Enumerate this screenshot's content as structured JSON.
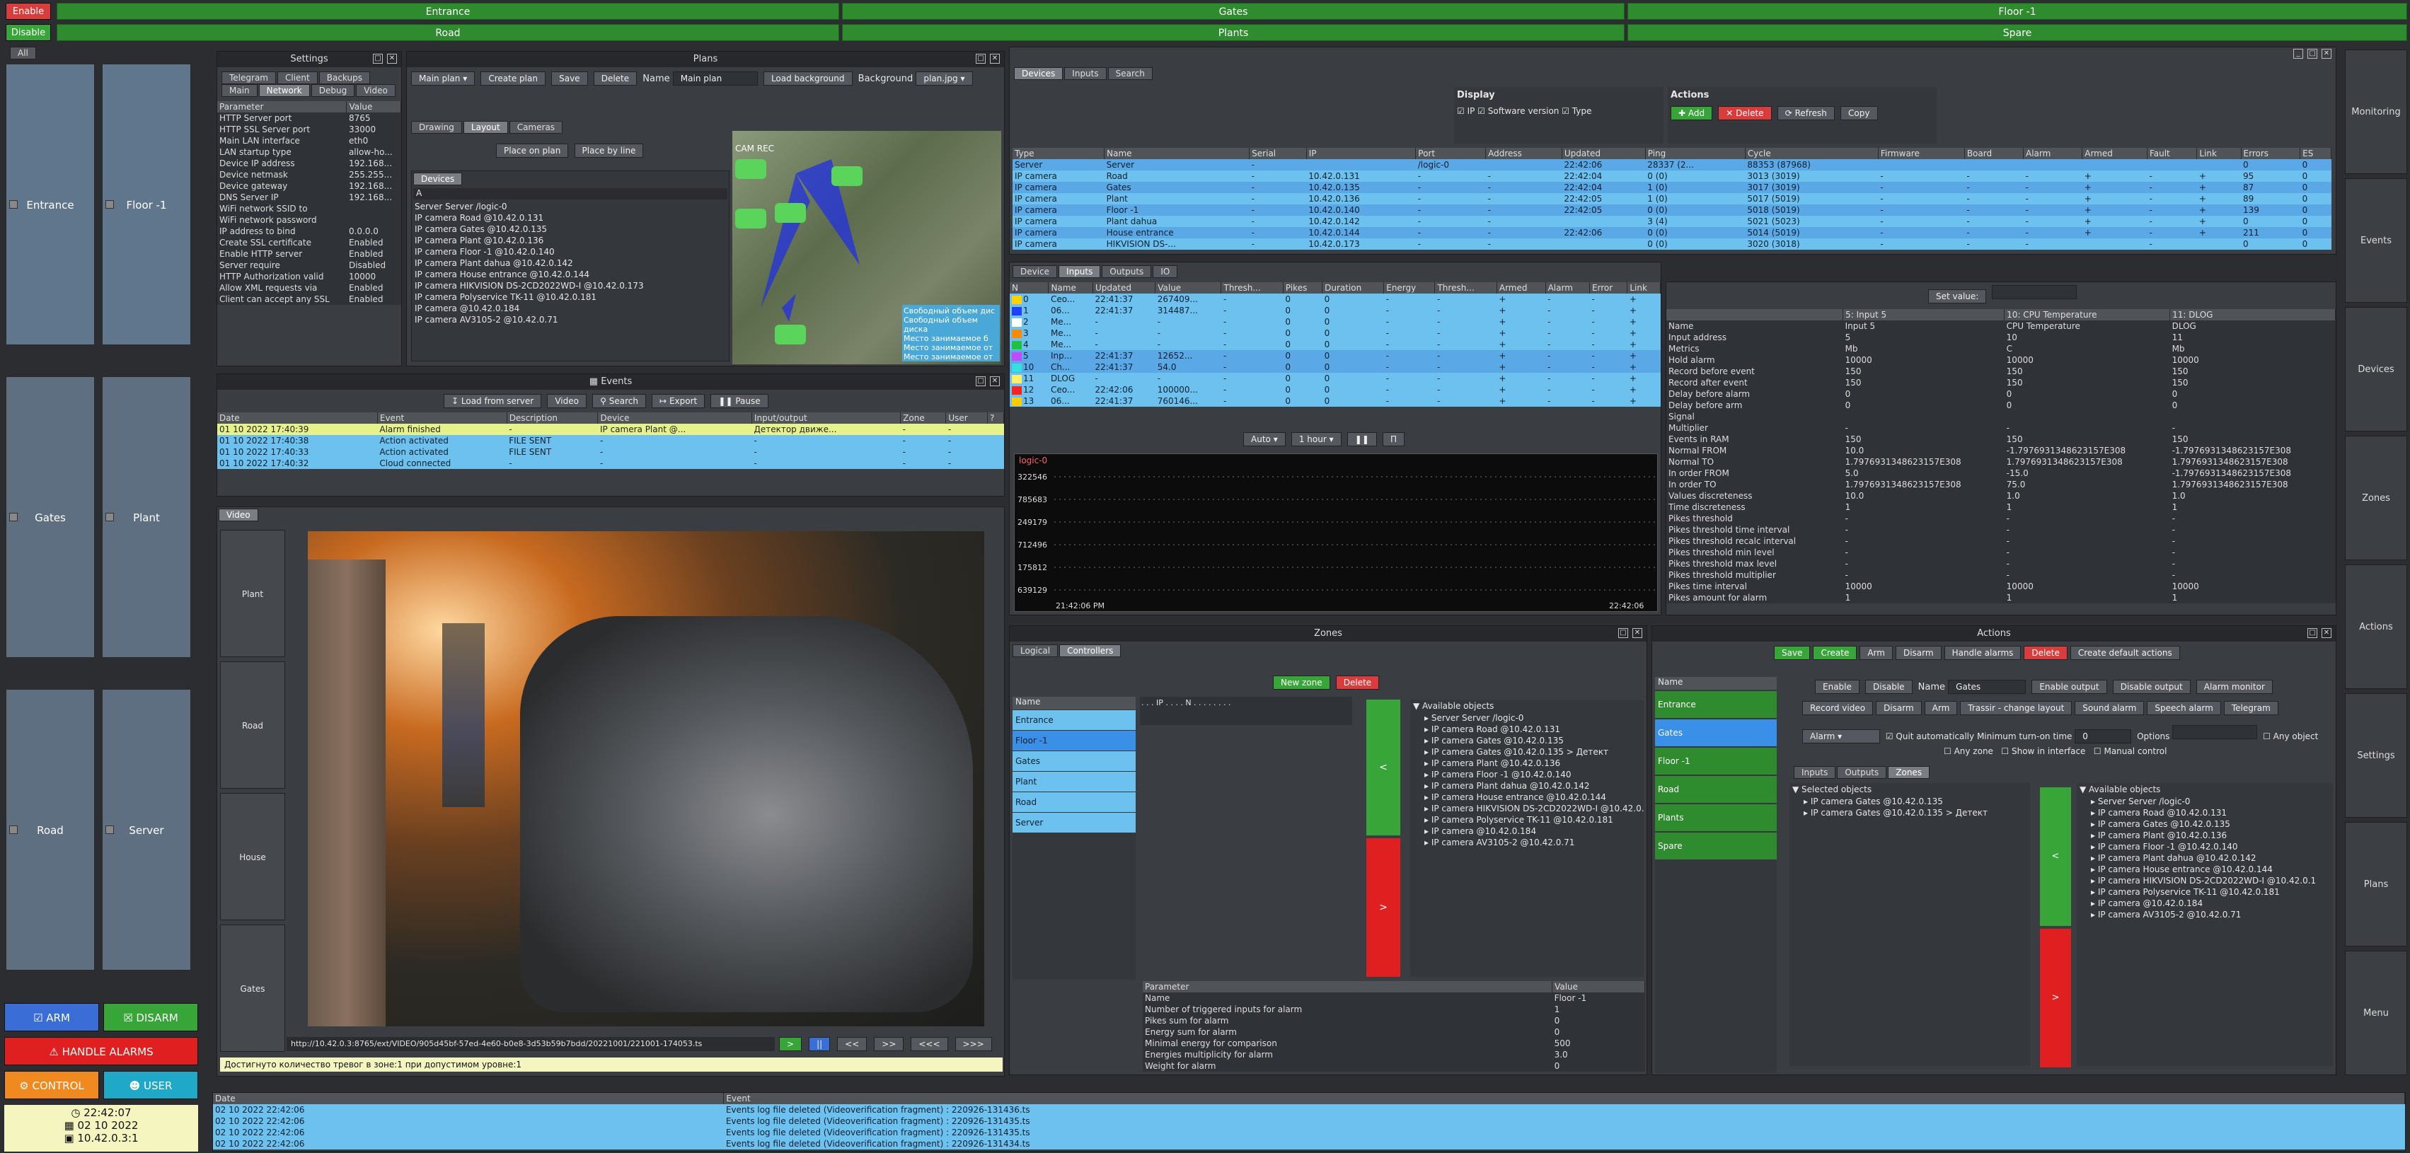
{
  "header": {
    "enable": "Enable",
    "disable": "Disable",
    "top_bars": [
      "Entrance",
      "Gates",
      "Floor -1"
    ],
    "bottom_bars": [
      "Road",
      "Plants",
      "Spare"
    ]
  },
  "sidebar": {
    "all_tab": "All",
    "zones": [
      "Entrance",
      "Floor -1",
      "Gates",
      "Plant",
      "Road",
      "Server"
    ],
    "arm": "ARM",
    "disarm": "DISARM",
    "handle_alarms": "HANDLE ALARMS",
    "control": "CONTROL",
    "user": "USER",
    "time": "22:42:07",
    "date": "02 10 2022",
    "ip": "10.42.0.3:1"
  },
  "settings": {
    "title": "Settings",
    "tabs1": [
      "Telegram",
      "Client",
      "Backups"
    ],
    "tabs2": [
      "Main",
      "Network",
      "Debug",
      "Video"
    ],
    "headers": [
      "Parameter",
      "Value"
    ],
    "rows": [
      [
        "HTTP Server port",
        "8765"
      ],
      [
        "HTTP SSL Server port",
        "33000"
      ],
      [
        "Main LAN interface",
        "eth0"
      ],
      [
        "LAN startup type",
        "allow-ho..."
      ],
      [
        "Device IP address",
        "192.168..."
      ],
      [
        "Device netmask",
        "255.255..."
      ],
      [
        "Device gateway",
        "192.168..."
      ],
      [
        "DNS Server IP",
        "192.168..."
      ],
      [
        "WiFi network SSID to",
        ""
      ],
      [
        "WiFi network password",
        ""
      ],
      [
        "IP address to bind",
        "0.0.0.0"
      ],
      [
        "Create SSL certificate",
        "Enabled"
      ],
      [
        "Enable HTTP server",
        "Enabled"
      ],
      [
        "Server require",
        "Disabled"
      ],
      [
        "HTTP Authorization valid",
        "10000"
      ],
      [
        "Allow XML requests via",
        "Enabled"
      ],
      [
        "Client can accept any SSL",
        "Enabled"
      ]
    ]
  },
  "plans": {
    "title": "Plans",
    "plan_select": "Main plan",
    "create": "Create plan",
    "save": "Save",
    "delete": "Delete",
    "name_label": "Name",
    "name_value": "Main plan",
    "load_bg": "Load background",
    "bg_label": "Background",
    "bg_value": "plan.jpg",
    "tabs": [
      "Drawing",
      "Layout",
      "Cameras"
    ],
    "place_on": "Place on plan",
    "place_line": "Place by line",
    "devices_tab": "Devices",
    "filter": "A",
    "devices": [
      "Server Server /logic-0",
      "IP camera Road @10.42.0.131",
      "IP camera Gates @10.42.0.135",
      "IP camera Plant @10.42.0.136",
      "IP camera Floor -1 @10.42.0.140",
      "IP camera Plant dahua @10.42.0.142",
      "IP camera House entrance @10.42.0.144",
      "IP camera HIKVISION DS-2CD2022WD-I @10.42.0.173",
      "IP camera Polyservice TK-11 @10.42.0.181",
      "IP camera @10.42.0.184",
      "IP camera AV3105-2 @10.42.0.71"
    ],
    "map_label": "CAM REC",
    "map_legend": [
      "Свободный объем дис",
      "Свободный объем диска",
      "Место занимаемое б",
      "Место занимаемое от",
      "Место занимаемое от"
    ]
  },
  "events": {
    "title": "Events",
    "load": "Load from server",
    "video": "Video",
    "search": "Search",
    "export": "Export",
    "pause": "Pause",
    "headers": [
      "Date",
      "Event",
      "Description",
      "Device",
      "Input/output",
      "Zone",
      "User",
      "?"
    ],
    "rows": [
      [
        "01 10 2022 17:40:39",
        "Alarm finished",
        "-",
        "IP camera Plant @...",
        "Детектор движе...",
        "-",
        "-",
        ""
      ],
      [
        "01 10 2022 17:40:38",
        "Action activated",
        "FILE SENT",
        "-",
        "-",
        "-",
        "-",
        ""
      ],
      [
        "01 10 2022 17:40:33",
        "Action activated",
        "FILE SENT",
        "-",
        "-",
        "-",
        "-",
        ""
      ],
      [
        "01 10 2022 17:40:32",
        "Cloud connected",
        "-",
        "-",
        "-",
        "-",
        "-",
        ""
      ]
    ]
  },
  "video": {
    "tab": "Video",
    "cams": [
      "Plant",
      "Road",
      "House entrance",
      "Gates"
    ],
    "url": "http://10.42.0.3:8765/ext/VIDEO/905d45bf-57ed-4e60-b0e8-3d53b59b7bdd/20221001/221001-174053.ts",
    "controls": [
      ">",
      "||",
      "<<",
      ">>",
      "<<<",
      ">>>"
    ],
    "status": "Достигнуто количество тревог в зоне:1 при допустимом уровне:1"
  },
  "devices_panel": {
    "tabs": [
      "Devices",
      "Inputs",
      "Search"
    ],
    "display_title": "Display",
    "display_opts": [
      "IP",
      "Software version",
      "Type"
    ],
    "actions_title": "Actions",
    "add": "Add",
    "delete": "Delete",
    "refresh": "Refresh",
    "copy": "Copy",
    "headers": [
      "Type",
      "Name",
      "Serial",
      "IP",
      "Port",
      "Address",
      "Updated",
      "Ping",
      "Cycle",
      "Firmware",
      "Board",
      "Alarm",
      "Armed",
      "Fault",
      "Link",
      "Errors",
      "ES"
    ],
    "rows": [
      [
        "Server",
        "Server",
        "-",
        "",
        "/logic-0",
        "",
        "22:42:06",
        "28337 (2...",
        "88353 (87968)",
        "",
        "",
        "",
        "",
        "",
        "",
        "0",
        "0"
      ],
      [
        "IP camera",
        "Road",
        "-",
        "10.42.0.131",
        "-",
        "-",
        "22:42:04",
        "0 (0)",
        "3013 (3019)",
        "-",
        "-",
        "-",
        "+",
        "-",
        "+",
        "95",
        "0"
      ],
      [
        "IP camera",
        "Gates",
        "-",
        "10.42.0.135",
        "-",
        "-",
        "22:42:04",
        "1 (0)",
        "3017 (3019)",
        "-",
        "-",
        "-",
        "+",
        "-",
        "+",
        "87",
        "0"
      ],
      [
        "IP camera",
        "Plant",
        "-",
        "10.42.0.136",
        "-",
        "-",
        "22:42:05",
        "1 (0)",
        "5017 (5019)",
        "-",
        "-",
        "-",
        "+",
        "-",
        "+",
        "89",
        "0"
      ],
      [
        "IP camera",
        "Floor -1",
        "-",
        "10.42.0.140",
        "-",
        "-",
        "22:42:05",
        "0 (0)",
        "5018 (5019)",
        "-",
        "-",
        "-",
        "+",
        "-",
        "+",
        "139",
        "0"
      ],
      [
        "IP camera",
        "Plant dahua",
        "-",
        "10.42.0.142",
        "-",
        "-",
        "",
        "3 (4)",
        "5021 (5023)",
        "-",
        "-",
        "-",
        "+",
        "-",
        "+",
        "0",
        "0"
      ],
      [
        "IP camera",
        "House entrance",
        "-",
        "10.42.0.144",
        "-",
        "-",
        "22:42:06",
        "0 (0)",
        "5014 (5019)",
        "-",
        "-",
        "-",
        "+",
        "-",
        "+",
        "211",
        "0"
      ],
      [
        "IP camera",
        "HIKVISION DS-...",
        "-",
        "10.42.0.173",
        "-",
        "-",
        "",
        "0 (0)",
        "3020 (3018)",
        "-",
        "-",
        "-",
        "",
        "-",
        "",
        "0",
        "0"
      ]
    ]
  },
  "inputs_panel": {
    "tabs": [
      "Device",
      "Inputs",
      "Outputs",
      "IO"
    ],
    "headers": [
      "N",
      "Name",
      "Updated",
      "Value",
      "Thresh...",
      "Pikes",
      "Duration",
      "Energy",
      "Thresh...",
      "Armed",
      "Alarm",
      "Error",
      "Link"
    ],
    "rows": [
      [
        "0",
        "Ceo...",
        "22:41:37",
        "267409...",
        "-",
        "0",
        "0",
        "-",
        "-",
        "+",
        "-",
        "-",
        "+"
      ],
      [
        "1",
        "06...",
        "22:41:37",
        "314487...",
        "-",
        "0",
        "0",
        "-",
        "-",
        "+",
        "-",
        "-",
        "+"
      ],
      [
        "2",
        "Me...",
        "-",
        "-",
        "-",
        "0",
        "0",
        "-",
        "-",
        "+",
        "-",
        "-",
        "+"
      ],
      [
        "3",
        "Me...",
        "-",
        "-",
        "-",
        "0",
        "0",
        "-",
        "-",
        "+",
        "-",
        "-",
        "+"
      ],
      [
        "4",
        "Me...",
        "-",
        "-",
        "-",
        "0",
        "0",
        "-",
        "-",
        "+",
        "-",
        "-",
        "+"
      ],
      [
        "5",
        "Inp...",
        "22:41:37",
        "12652...",
        "-",
        "0",
        "0",
        "-",
        "-",
        "+",
        "-",
        "-",
        "+"
      ],
      [
        "10",
        "Ch...",
        "22:41:37",
        "54.0",
        "-",
        "0",
        "0",
        "-",
        "-",
        "+",
        "-",
        "-",
        "+"
      ],
      [
        "11",
        "DLOG",
        "-",
        "-",
        "-",
        "0",
        "0",
        "-",
        "-",
        "+",
        "-",
        "-",
        "+"
      ],
      [
        "12",
        "Ceo...",
        "22:42:06",
        "100000...",
        "-",
        "0",
        "0",
        "-",
        "-",
        "+",
        "-",
        "-",
        "+"
      ],
      [
        "13",
        "06...",
        "22:41:37",
        "760146...",
        "-",
        "0",
        "0",
        "-",
        "-",
        "+",
        "-",
        "-",
        "+"
      ]
    ],
    "chip_colors": [
      "#ffd200",
      "#2040ff",
      "#ffffff",
      "#ff8800",
      "#20c040",
      "#c04cff",
      "#33e0e0",
      "#ffee66",
      "#ff2020",
      "#ffcc00"
    ],
    "auto": "Auto",
    "period": "1 hour",
    "graph_label": "logic-0",
    "y_ticks": [
      "322546",
      "785683",
      "249179",
      "712496",
      "175812",
      "639129"
    ],
    "x_ticks": [
      "21:42:06 PM",
      "22:42:06"
    ]
  },
  "params_panel": {
    "set_value": "Set value:",
    "col_headers": [
      "",
      "5: Input 5",
      "10: CPU Temperature",
      "11: DLOG"
    ],
    "rows": [
      [
        "Name",
        "Input 5",
        "CPU Temperature",
        "DLOG"
      ],
      [
        "Input address",
        "5",
        "10",
        "11"
      ],
      [
        "Metrics",
        "Mb",
        "C",
        "Mb"
      ],
      [
        "Hold alarm",
        "10000",
        "10000",
        "10000"
      ],
      [
        "Record before event",
        "150",
        "150",
        "150"
      ],
      [
        "Record after event",
        "150",
        "150",
        "150"
      ],
      [
        "Delay before alarm",
        "0",
        "0",
        "0"
      ],
      [
        "Delay before arm",
        "0",
        "0",
        "0"
      ],
      [
        "Signal",
        "",
        "",
        ""
      ],
      [
        "Multiplier",
        "-",
        "-",
        "-"
      ],
      [
        "Events in RAM",
        "150",
        "150",
        "150"
      ],
      [
        "Normal FROM",
        "10.0",
        "-1.7976931348623157E308",
        "-1.7976931348623157E308"
      ],
      [
        "Normal TO",
        "1.7976931348623157E308",
        "1.7976931348623157E308",
        "1.7976931348623157E308"
      ],
      [
        "In order FROM",
        "5.0",
        "-15.0",
        "-1.7976931348623157E308"
      ],
      [
        "In order TO",
        "1.7976931348623157E308",
        "75.0",
        "1.7976931348623157E308"
      ],
      [
        "Values discreteness",
        "10.0",
        "1.0",
        "1.0"
      ],
      [
        "Time discreteness",
        "1",
        "1",
        "1"
      ],
      [
        "Pikes threshold",
        "-",
        "-",
        "-"
      ],
      [
        "Pikes threshold time interval",
        "-",
        "-",
        "-"
      ],
      [
        "Pikes threshold recalc interval",
        "-",
        "-",
        "-"
      ],
      [
        "Pikes threshold min level",
        "-",
        "-",
        "-"
      ],
      [
        "Pikes threshold max level",
        "-",
        "-",
        "-"
      ],
      [
        "Pikes threshold multiplier",
        "-",
        "-",
        "-"
      ],
      [
        "Pikes time interval",
        "10000",
        "10000",
        "10000"
      ],
      [
        "Pikes amount for alarm",
        "1",
        "1",
        "1"
      ]
    ]
  },
  "zones_panel": {
    "title": "Zones",
    "tabs": [
      "Logical",
      "Controllers"
    ],
    "new_zone": "New zone",
    "delete": "Delete",
    "name_header": "Name",
    "zones": [
      "Entrance",
      "Floor -1",
      "Gates",
      "Plant",
      "Road",
      "Server"
    ],
    "available": "Available objects",
    "tree": [
      "Server Server /logic-0",
      "IP camera Road @10.42.0.131",
      "IP camera Gates @10.42.0.135",
      "IP camera Gates @10.42.0.135 > Детект",
      "IP camera Plant @10.42.0.136",
      "IP camera Floor -1 @10.42.0.140",
      "IP camera Plant dahua @10.42.0.142",
      "IP camera House entrance @10.42.0.144",
      "IP camera HIKVISION DS-2CD2022WD-I @10.42.0.173",
      "IP camera Polyservice TK-11 @10.42.0.181",
      "IP camera @10.42.0.184",
      "IP camera AV3105-2 @10.42.0.71"
    ],
    "param_headers": [
      "Parameter",
      "Value"
    ],
    "params": [
      [
        "Name",
        "Floor -1"
      ],
      [
        "Number of triggered inputs for alarm",
        "1"
      ],
      [
        "Pikes sum for alarm",
        "0"
      ],
      [
        "Energy sum for alarm",
        "0"
      ],
      [
        "Minimal energy for comparison",
        "500"
      ],
      [
        "Energies multiplicity for alarm",
        "3.0"
      ],
      [
        "Weight for alarm",
        "0"
      ]
    ]
  },
  "actions_panel": {
    "title": "Actions",
    "top_btns": [
      "Save",
      "Create",
      "Arm",
      "Disarm",
      "Handle alarms",
      "Delete",
      "Create default actions"
    ],
    "name_header": "Name",
    "list": [
      "Entrance",
      "Gates",
      "Floor -1",
      "Road",
      "Plants",
      "Spare"
    ],
    "row2": [
      "Enable",
      "Disable"
    ],
    "name_label": "Name",
    "name_value": "Gates",
    "row2b": [
      "Enable output",
      "Disable output",
      "Alarm monitor"
    ],
    "row3": [
      "Record video",
      "Disarm",
      "Arm",
      "Trassir - change layout",
      "Sound alarm",
      "Speech alarm",
      "Telegram"
    ],
    "type_value": "Alarm",
    "quit_auto": "Quit automatically",
    "min_turn_on": "Minimum turn-on time",
    "min_value": "0",
    "options": "Options",
    "any_object": "Any object",
    "any_zone": "Any zone",
    "show_iface": "Show in interface",
    "manual": "Manual control",
    "io_tabs": [
      "Inputs",
      "Outputs",
      "Zones"
    ],
    "selected": "Selected objects",
    "selected_tree": [
      "IP camera Gates @10.42.0.135",
      "IP camera Gates @10.42.0.135 > Детект"
    ],
    "available": "Available objects",
    "avail_tree": [
      "Server Server /logic-0",
      "IP camera Road @10.42.0.131",
      "IP camera Gates @10.42.0.135",
      "IP camera Plant @10.42.0.136",
      "IP camera Floor -1 @10.42.0.140",
      "IP camera Plant dahua @10.42.0.142",
      "IP camera House entrance @10.42.0.144",
      "IP camera HIKVISION DS-2CD2022WD-I @10.42.0.1",
      "IP camera Polyservice TK-11 @10.42.0.181",
      "IP camera @10.42.0.184",
      "IP camera AV3105-2 @10.42.0.71"
    ]
  },
  "right_nav": [
    "Monitoring",
    "Events",
    "Devices",
    "Zones",
    "Actions",
    "Settings",
    "Plans",
    "Menu"
  ],
  "log": {
    "headers": [
      "Date",
      "Event"
    ],
    "rows": [
      [
        "02 10 2022 22:42:06",
        "Events log file deleted (Videoverification fragment) : 220926-131436.ts"
      ],
      [
        "02 10 2022 22:42:06",
        "Events log file deleted (Videoverification fragment) : 220926-131435.ts"
      ],
      [
        "02 10 2022 22:42:06",
        "Events log file deleted (Videoverification fragment) : 220926-131435.ts"
      ],
      [
        "02 10 2022 22:42:06",
        "Events log file deleted (Videoverification fragment) : 220926-131434.ts"
      ]
    ]
  }
}
